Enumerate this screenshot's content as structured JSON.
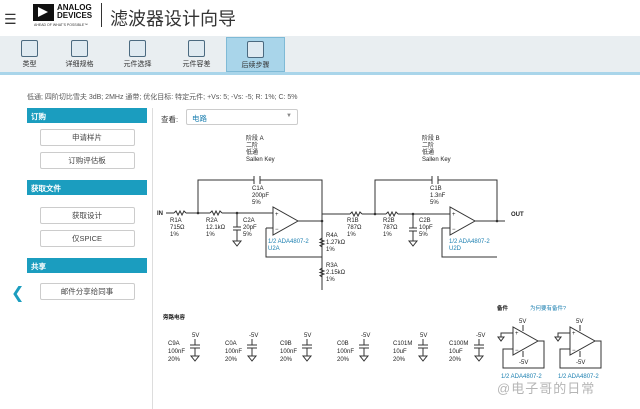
{
  "header": {
    "title": "滤波器设计向导",
    "logo_line1": "ANALOG",
    "logo_line2": "DEVICES",
    "logo_tagline": "AHEAD OF WHAT'S POSSIBLE™",
    "menu_icon": "hamburger-icon"
  },
  "tabs": [
    {
      "label": "类型"
    },
    {
      "label": "详细规格"
    },
    {
      "label": "元件选择"
    },
    {
      "label": "元件容差"
    },
    {
      "label": "后续步骤",
      "active": true
    }
  ],
  "summary": "低通; 四阶切比雪夫 3dB; 2MHz 通带; 优化目标: 特定元件; +Vs: 5; -Vs: -5; R: 1%; C: 5%",
  "sidebar": {
    "order": {
      "title": "订购",
      "buttons": [
        "申请样片",
        "订购评估板"
      ]
    },
    "files": {
      "title": "获取文件",
      "buttons": [
        "获取设计",
        "仅SPICE"
      ]
    },
    "share": {
      "title": "共享",
      "buttons": [
        "邮件分享给同事"
      ]
    }
  },
  "view": {
    "label": "查看:",
    "selected": "电路"
  },
  "schematic": {
    "in": "IN",
    "out": "OUT",
    "stageA": [
      "阶段 A",
      "二阶",
      "低通",
      "Sallen Key"
    ],
    "stageB": [
      "阶段 B",
      "二阶",
      "低通",
      "Sallen Key"
    ],
    "C1A": [
      "C1A",
      "200pF",
      "5%"
    ],
    "R1A": [
      "R1A",
      "715Ω",
      "1%"
    ],
    "R2A": [
      "R2A",
      "12.1kΩ",
      "1%"
    ],
    "C2A": [
      "C2A",
      "20pF",
      "5%"
    ],
    "U2A": [
      "1/2 ADA4807-2",
      "U2A"
    ],
    "R4A": [
      "R4A",
      "1.27kΩ",
      "1%"
    ],
    "R3A": [
      "R3A",
      "2.15kΩ",
      "1%"
    ],
    "C1B": [
      "C1B",
      "1.3nF",
      "5%"
    ],
    "R1B": [
      "R1B",
      "787Ω",
      "1%"
    ],
    "R2B": [
      "R2B",
      "787Ω",
      "1%"
    ],
    "C2B": [
      "C2B",
      "10pF",
      "5%"
    ],
    "U2B": [
      "1/2 ADA4807-2",
      "U2D"
    ]
  },
  "bypass": {
    "title": "旁路电容",
    "caps": [
      {
        "name": "C9A",
        "value": "100nF",
        "tol": "20%",
        "rail": "5V"
      },
      {
        "name": "C0A",
        "value": "100nF",
        "tol": "20%",
        "rail": "-5V"
      },
      {
        "name": "C9B",
        "value": "100nF",
        "tol": "20%",
        "rail": "5V"
      },
      {
        "name": "C0B",
        "value": "100nF",
        "tol": "20%",
        "rail": "-5V"
      },
      {
        "name": "C101M",
        "value": "10uF",
        "tol": "20%",
        "rail": "5V"
      },
      {
        "name": "C100M",
        "value": "10uF",
        "tol": "20%",
        "rail": "-5V"
      }
    ]
  },
  "spares": {
    "title": "备件",
    "link": "为何要有备件?",
    "parts": [
      {
        "label": "1/2 ADA4807-2",
        "pos": "5V",
        "neg": "-5V"
      },
      {
        "label": "1/2 ADA4807-2",
        "pos": "5V",
        "neg": "-5V"
      }
    ]
  },
  "watermark": "@电子哥的日常"
}
